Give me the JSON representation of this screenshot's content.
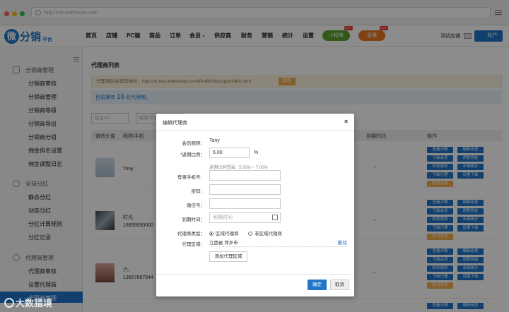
{
  "browser": {
    "url": "http://mp.wxfenxiao.com"
  },
  "logo": {
    "glyph": "微",
    "name": "分销",
    "suffix": "平台"
  },
  "topnav": {
    "items": [
      "首页",
      "店铺",
      "PC端",
      "商品",
      "订单",
      "会员",
      "供应商",
      "财务",
      "营销",
      "统计",
      "设置"
    ],
    "member_dropdown_icon": "caret-down-icon",
    "miniapp": "小程序",
    "live": "直播",
    "hot": "HOT",
    "store": "测试店铺",
    "account": "账户",
    "colors": {
      "brand": "#1f76c8",
      "miniapp": "#5aa02c",
      "live": "#e87722"
    }
  },
  "sidebar": {
    "groups": [
      {
        "title": "分销商管理",
        "items": [
          "分销商审核",
          "分销商管理",
          "分销商等级",
          "分销商导出",
          "分销商分组",
          "佣金排名设置",
          "佣金调整日志"
        ]
      },
      {
        "title": "全球分红",
        "items": [
          "静态分红",
          "动态分红",
          "分红计算规则",
          "分红记录"
        ]
      },
      {
        "title": "代理商管理",
        "items": [
          "代理商审核",
          "设置代理商",
          "代理商管理"
        ]
      }
    ]
  },
  "main": {
    "title": "代理商列表",
    "login_note": "代理商后台登陆地址：http://m.test.wxfenxiao.com/Public/dlsLogin/sid/6.html",
    "copy_label": "复制",
    "count_prefix": "目前拥有",
    "count": "16",
    "count_suffix": "名代理商。",
    "filters": {
      "nickname": "姓名/ID",
      "phone": "昵称/手机"
    },
    "columns": [
      "微信头像",
      "昵称/手机",
      "到期时间",
      "操作"
    ],
    "rows": [
      {
        "name": "Tony",
        "phone": "",
        "expire": "--",
        "ops": [
          "查看详情",
          "编辑信息",
          "下级会员",
          "调整佣金",
          "财务报表",
          "业绩统计",
          "下级代理",
          "设置下级",
          "取消资格"
        ]
      },
      {
        "name": "时光",
        "phone": "18899990000",
        "expire": "--",
        "ops": [
          "查看详情",
          "编辑信息",
          "下级会员",
          "调整佣金",
          "财务报表",
          "业绩统计",
          "下级代理",
          "设置下级",
          "取消资格"
        ]
      },
      {
        "name": "六、",
        "phone": "13657687844",
        "expire": "--",
        "ops": [
          "查看详情",
          "编辑信息",
          "下级会员",
          "调整佣金",
          "财务报表",
          "业绩统计",
          "下级代理",
          "设置下级",
          "取消资格"
        ]
      }
    ],
    "last_row_ops": [
      "查看详情",
      "编辑信息"
    ]
  },
  "modal": {
    "title": "编辑代理商",
    "close": "×",
    "member_label": "会员昵称：",
    "member_value": "Tony",
    "ratio_label": "*返佣比例：",
    "ratio_value": "6.00",
    "ratio_unit": "%",
    "ratio_hint": "返佣比例范围：5.00% ~ 7.00%",
    "phone_label": "登录手机号：",
    "password_label": "密码：",
    "wechat_label": "微信号：",
    "expire_label": "到期时间：",
    "expire_placeholder": "到期时间",
    "type_label": "代理商类型：",
    "type_options": [
      "区域代理商",
      "非区域代理商"
    ],
    "type_selected": "区域代理商",
    "region_label": "代理区域：",
    "region_value": "江西省 萍乡市",
    "region_delete": "删除",
    "add_region": "添加代理区域",
    "ok": "确定",
    "cancel": "取消"
  },
  "watermark": "大数猎境"
}
